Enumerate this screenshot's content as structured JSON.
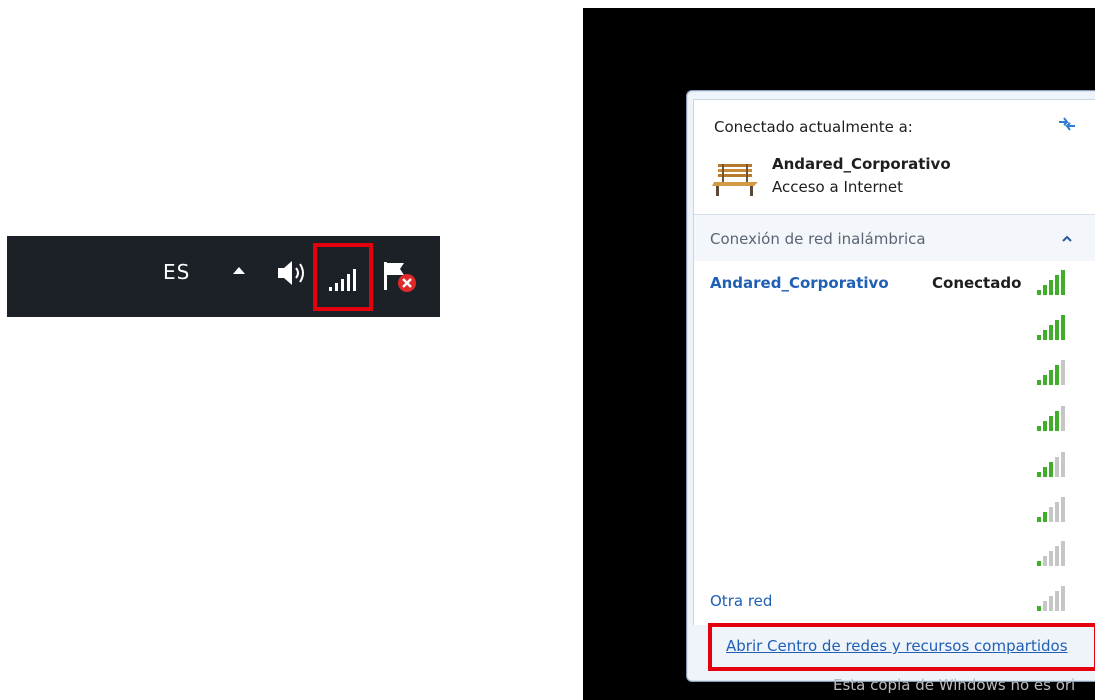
{
  "taskbar": {
    "language": "ES",
    "icons": [
      "show-hidden-icons-chevron",
      "speaker-icon",
      "network-signal-icon",
      "action-center-flag-icon"
    ],
    "highlight_color": "#e5000e"
  },
  "popup": {
    "current_label": "Conectado actualmente a:",
    "current_network": {
      "name": "Andared_Corporativo",
      "access": "Acceso a Internet",
      "icon": "bench-icon"
    },
    "section_title": "Conexión de red inalámbrica",
    "networks": [
      {
        "name": "Andared_Corporativo",
        "status": "Conectado",
        "signal": 5
      },
      {
        "name": "",
        "status": "",
        "signal": 5
      },
      {
        "name": "",
        "status": "",
        "signal": 4
      },
      {
        "name": "",
        "status": "",
        "signal": 4
      },
      {
        "name": "",
        "status": "",
        "signal": 3
      },
      {
        "name": "",
        "status": "",
        "signal": 2
      },
      {
        "name": "",
        "status": "",
        "signal": 1
      },
      {
        "name": "Otra red",
        "status": "",
        "signal": 1
      }
    ],
    "other_network": "Otra red",
    "footer_link": "Abrir Centro de redes y recursos compartidos",
    "accent_green": "#3fae2a",
    "link_color": "#1f5fb5"
  },
  "watermark": "Esta copia de Windows no es ori"
}
